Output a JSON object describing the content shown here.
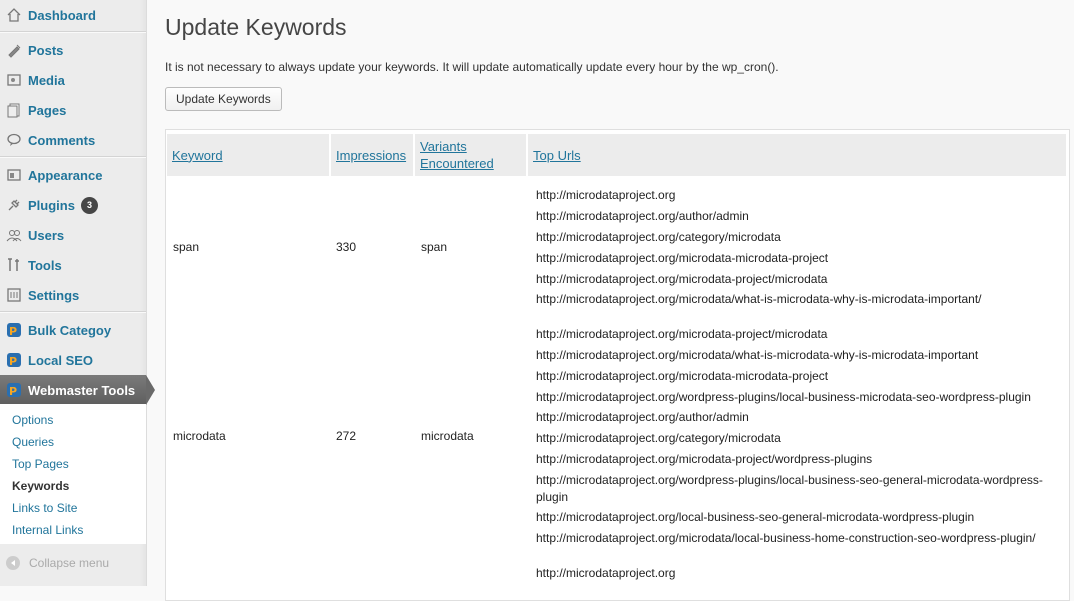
{
  "sidebar": {
    "items": [
      {
        "label": "Dashboard",
        "icon": "dashboard-icon"
      },
      {
        "label": "Posts",
        "icon": "posts-icon"
      },
      {
        "label": "Media",
        "icon": "media-icon"
      },
      {
        "label": "Pages",
        "icon": "pages-icon"
      },
      {
        "label": "Comments",
        "icon": "comments-icon"
      },
      {
        "label": "Appearance",
        "icon": "appearance-icon"
      },
      {
        "label": "Plugins",
        "icon": "plugins-icon",
        "badge": "3"
      },
      {
        "label": "Users",
        "icon": "users-icon"
      },
      {
        "label": "Tools",
        "icon": "tools-icon"
      },
      {
        "label": "Settings",
        "icon": "settings-icon"
      },
      {
        "label": "Bulk Categoy",
        "icon": "plugin-logo-icon"
      },
      {
        "label": "Local SEO",
        "icon": "plugin-logo-icon"
      },
      {
        "label": "Webmaster Tools",
        "icon": "plugin-logo-icon"
      }
    ],
    "submenu": [
      "Options",
      "Queries",
      "Top Pages",
      "Keywords",
      "Links to Site",
      "Internal Links"
    ],
    "active_submenu": "Keywords",
    "collapse_label": "Collapse menu"
  },
  "main": {
    "title": "Update Keywords",
    "intro": "It is not necessary to always update your keywords. It will update automatically update every hour by the wp_cron().",
    "button_label": "Update Keywords",
    "table": {
      "headers": [
        "Keyword",
        "Impressions",
        "Variants\nEncountered",
        "Top Urls"
      ],
      "header_variants_line1": "Variants",
      "header_variants_line2": "Encountered",
      "rows": [
        {
          "keyword": "span",
          "impressions": "330",
          "variants": "span",
          "urls": [
            "http://microdataproject.org",
            "http://microdataproject.org/author/admin",
            "http://microdataproject.org/category/microdata",
            "http://microdataproject.org/microdata-microdata-project",
            "http://microdataproject.org/microdata-project/microdata",
            "http://microdataproject.org/microdata/what-is-microdata-why-is-microdata-important/"
          ]
        },
        {
          "keyword": "microdata",
          "impressions": "272",
          "variants": "microdata",
          "urls": [
            "http://microdataproject.org/microdata-project/microdata",
            "http://microdataproject.org/microdata/what-is-microdata-why-is-microdata-important",
            "http://microdataproject.org/microdata-microdata-project",
            "http://microdataproject.org/wordpress-plugins/local-business-microdata-seo-wordpress-plugin",
            "http://microdataproject.org/author/admin",
            "http://microdataproject.org/category/microdata",
            "http://microdataproject.org/microdata-project/wordpress-plugins",
            "http://microdataproject.org/wordpress-plugins/local-business-seo-general-microdata-wordpress-",
            "plugin",
            "http://microdataproject.org/local-business-seo-general-microdata-wordpress-plugin",
            "http://microdataproject.org/microdata/local-business-home-construction-seo-wordpress-plugin/"
          ]
        },
        {
          "urls": [
            "http://microdataproject.org"
          ]
        }
      ]
    }
  }
}
